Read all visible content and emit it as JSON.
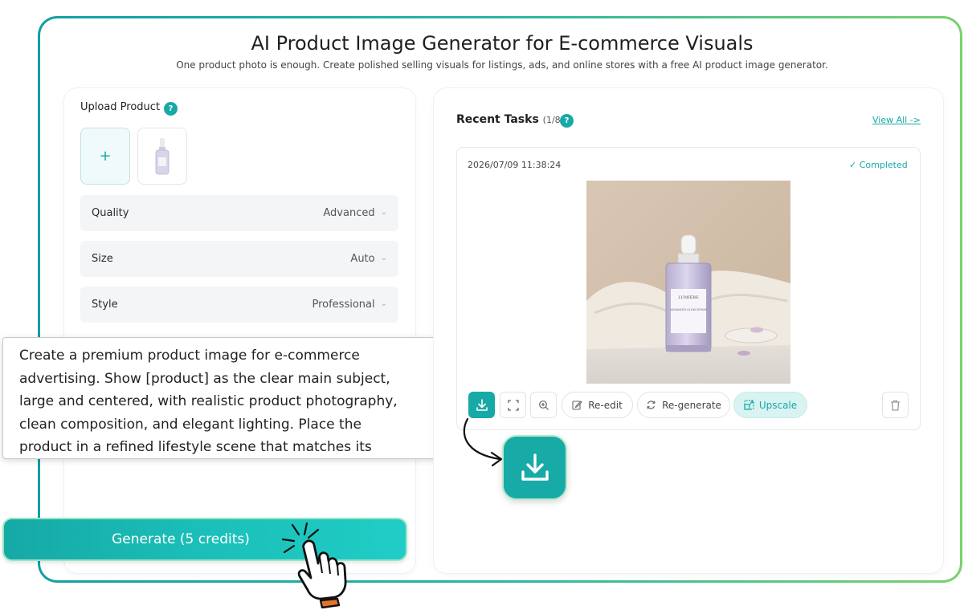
{
  "header": {
    "title": "AI Product Image Generator for E-commerce Visuals",
    "subtitle": "One product photo is enough. Create polished selling visuals for listings, ads, and online stores with a free AI product image generator."
  },
  "left_panel": {
    "upload_label": "Upload Product",
    "help_glyph": "?",
    "add_glyph": "+",
    "fields": [
      {
        "label": "Quality",
        "value": "Advanced"
      },
      {
        "label": "Size",
        "value": "Auto"
      },
      {
        "label": "Style",
        "value": "Professional"
      }
    ],
    "prompt_text": "Create a premium product image for e-commerce advertising. Show [product] as the clear main subject, large and centered, with realistic product photography, clean composition, and elegant lighting. Place the product in a refined lifestyle scene that matches its",
    "generate_label": "Generate (5 credits)"
  },
  "right_panel": {
    "recent_title": "Recent Tasks",
    "recent_count": "(1/8)",
    "view_all": "View All ->",
    "task": {
      "timestamp": "2026/07/09 11:38:24",
      "status": "✓ Completed",
      "bottle_label_brand": "LUMIÈRE",
      "bottle_label_name": "ADVANCED GLOW SERUM",
      "actions": {
        "reedit": "Re-edit",
        "regenerate": "Re-generate",
        "upscale": "Upscale"
      }
    }
  },
  "colors": {
    "accent": "#17a9a5",
    "border_gradient_start": "#139fa6",
    "border_gradient_end": "#7cd06f"
  }
}
